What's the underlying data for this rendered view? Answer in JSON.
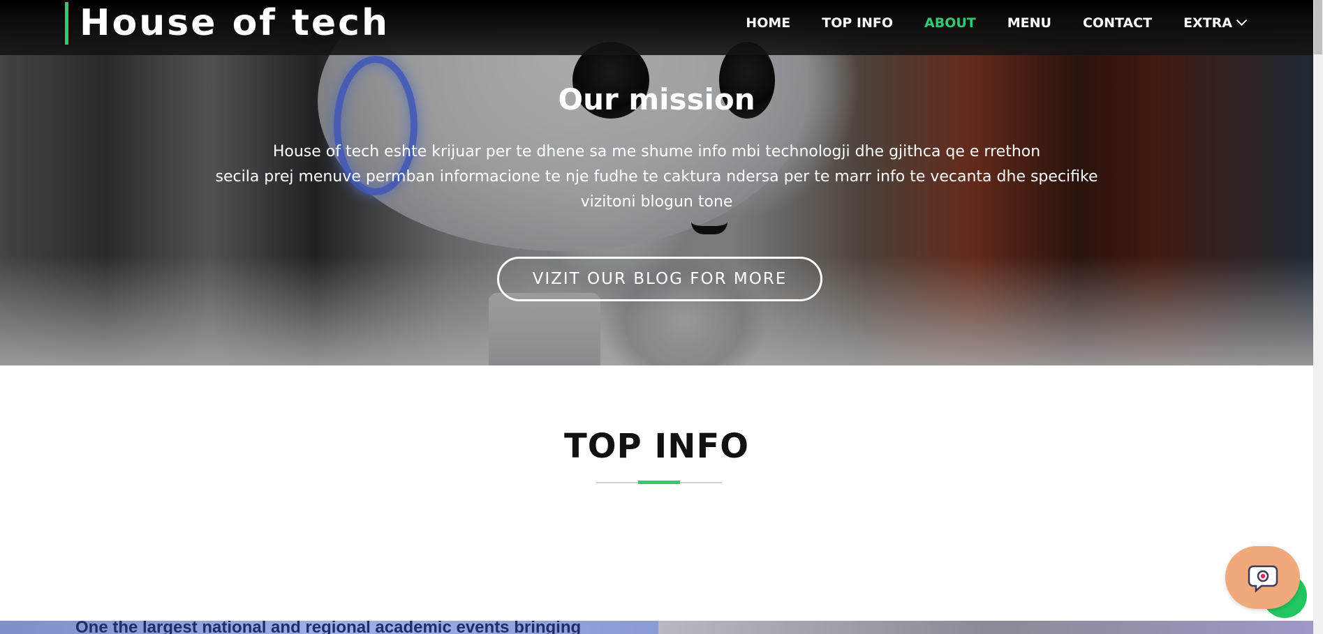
{
  "site": {
    "logo": "House of tech"
  },
  "nav": {
    "items": [
      {
        "label": "HOME",
        "active": false
      },
      {
        "label": "TOP INFO",
        "active": false
      },
      {
        "label": "ABOUT",
        "active": true
      },
      {
        "label": "MENU",
        "active": false
      },
      {
        "label": "CONTACT",
        "active": false
      },
      {
        "label": "EXTRA",
        "active": false,
        "icon": "chevron-down-icon"
      }
    ]
  },
  "hero": {
    "title": "Our mission",
    "lines": [
      "House of tech eshte krijuar per te dhene sa me shume info mbi technologji dhe gjithca qe e rrethon",
      "secila prej menuve permban informacione te nje fudhe te caktura ndersa per te marr info te vecanta dhe specifike",
      "vizitoni blogun tone"
    ],
    "button": "VIZIT OUR BLOG FOR MORE"
  },
  "section": {
    "title": "TOP INFO"
  },
  "bottom_strip": {
    "text": "One the largest national and regional academic events bringing"
  },
  "chat": {
    "icon": "chat-bubble-icon"
  },
  "colors": {
    "accent": "#2ecc71",
    "nav_bg": "#000000",
    "chat_bg": "#f0a97a"
  }
}
